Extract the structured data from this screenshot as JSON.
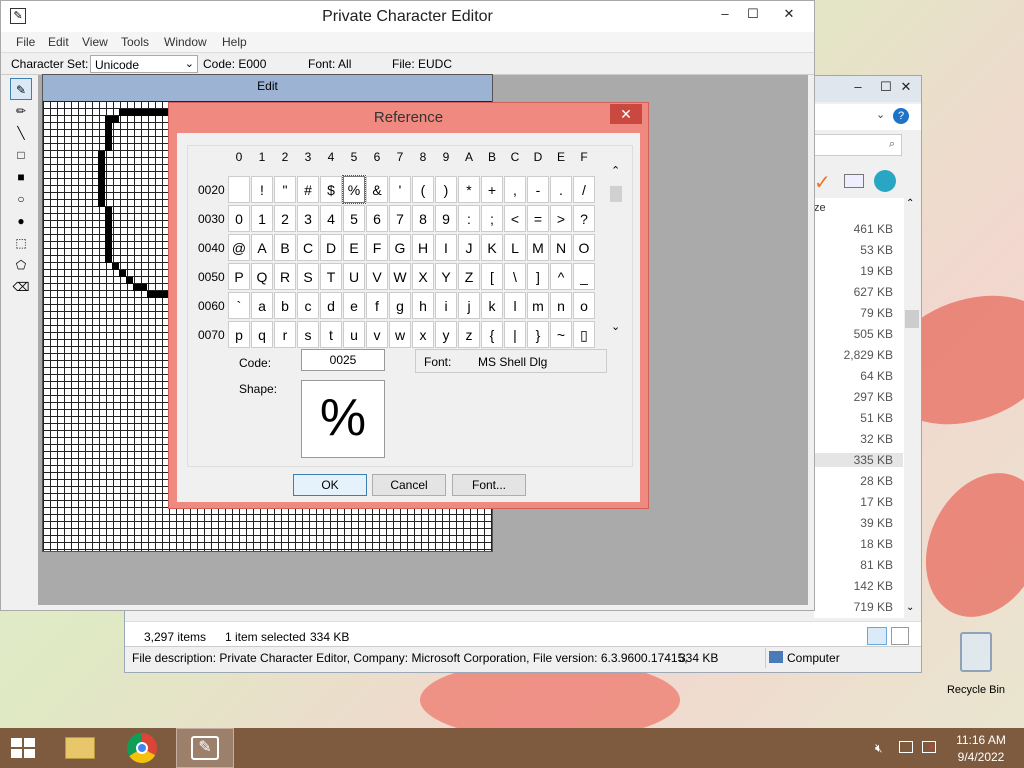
{
  "pce": {
    "title": "Private Character Editor",
    "menu": [
      "File",
      "Edit",
      "View",
      "Tools",
      "Window",
      "Help"
    ],
    "info": {
      "charset_label": "Character Set:",
      "charset_value": "Unicode",
      "code": "Code: E000",
      "font": "Font: All",
      "file": "File: EUDC"
    },
    "edit_header": "Edit",
    "tools": [
      "pencil-icon",
      "brush-icon",
      "line-icon",
      "hollow-rectangle-icon",
      "filled-rectangle-icon",
      "hollow-ellipse-icon",
      "filled-ellipse-icon",
      "rect-select-icon",
      "freeform-select-icon",
      "eraser-icon"
    ]
  },
  "explorer": {
    "column_header": "ze",
    "sizes": [
      "461 KB",
      "53 KB",
      "19 KB",
      "627 KB",
      "79 KB",
      "505 KB",
      "2,829 KB",
      "64 KB",
      "297 KB",
      "51 KB",
      "32 KB",
      "335 KB",
      "28 KB",
      "17 KB",
      "39 KB",
      "18 KB",
      "81 KB",
      "142 KB",
      "719 KB"
    ],
    "status": {
      "items": "3,297 items",
      "selected": "1 item selected",
      "size": "334 KB"
    },
    "description": "File description: Private Character Editor, Company: Microsoft Corporation, File version: 6.3.9600.17415,",
    "desc_size": "334 KB",
    "location": "Computer"
  },
  "reference": {
    "title": "Reference",
    "col_headers": [
      "0",
      "1",
      "2",
      "3",
      "4",
      "5",
      "6",
      "7",
      "8",
      "9",
      "A",
      "B",
      "C",
      "D",
      "E",
      "F"
    ],
    "rows": [
      {
        "label": "0020",
        "chars": [
          "",
          " !",
          "\"",
          "#",
          "$",
          "%",
          "&",
          "'",
          "(",
          ")",
          "*",
          "+",
          ",",
          "-",
          ".",
          "/"
        ]
      },
      {
        "label": "0030",
        "chars": [
          "0",
          "1",
          "2",
          "3",
          "4",
          "5",
          "6",
          "7",
          "8",
          "9",
          ":",
          ";",
          "<",
          "=",
          ">",
          "?"
        ]
      },
      {
        "label": "0040",
        "chars": [
          "@",
          "A",
          "B",
          "C",
          "D",
          "E",
          "F",
          "G",
          "H",
          "I",
          "J",
          "K",
          "L",
          "M",
          "N",
          "O"
        ]
      },
      {
        "label": "0050",
        "chars": [
          "P",
          "Q",
          "R",
          "S",
          "T",
          "U",
          "V",
          "W",
          "X",
          "Y",
          "Z",
          "[",
          "\\",
          "]",
          "^",
          "_"
        ]
      },
      {
        "label": "0060",
        "chars": [
          "`",
          "a",
          "b",
          "c",
          "d",
          "e",
          "f",
          "g",
          "h",
          "i",
          "j",
          "k",
          "l",
          "m",
          "n",
          "o"
        ]
      },
      {
        "label": "0070",
        "chars": [
          "p",
          "q",
          "r",
          "s",
          "t",
          "u",
          "v",
          "w",
          "x",
          "y",
          "z",
          "{",
          "|",
          "}",
          "~",
          "▯"
        ]
      }
    ],
    "code_label": "Code:",
    "code_value": "0025",
    "font_label": "Font:",
    "font_value": "MS Shell Dlg",
    "shape_label": "Shape:",
    "shape_char": "%",
    "ok": "OK",
    "cancel": "Cancel",
    "font_button": "Font..."
  },
  "desktop": {
    "recycle_bin": "Recycle Bin"
  },
  "taskbar": {
    "time": "11:16 AM",
    "date": "9/4/2022"
  }
}
